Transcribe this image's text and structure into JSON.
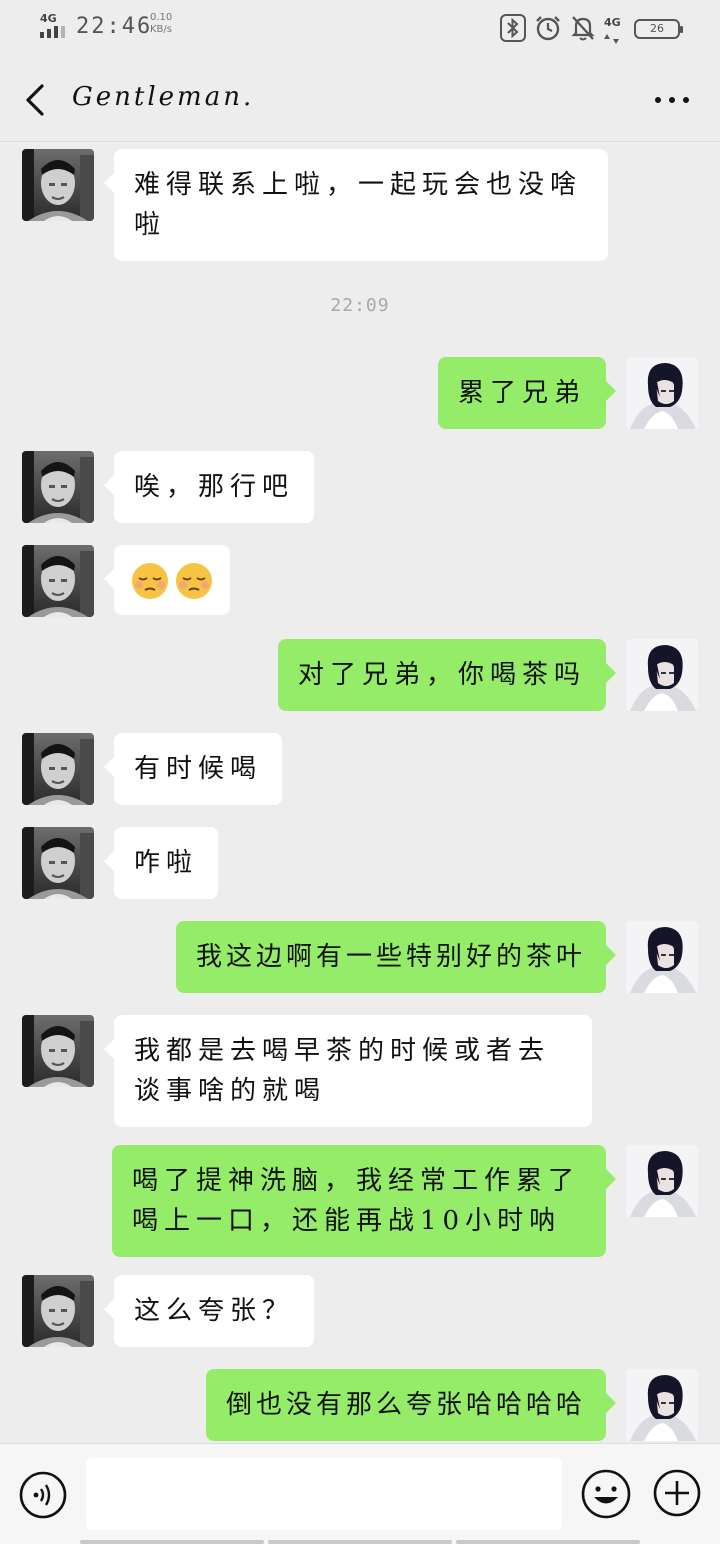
{
  "status_bar": {
    "network_type": "4G",
    "time": "22:46",
    "speed_value": "0.10",
    "speed_unit": "KB/s",
    "battery_level": "26",
    "right_network_type": "4G",
    "icons": [
      "signal-icon",
      "bluetooth-icon",
      "alarm-icon",
      "mute-icon",
      "mobile-data-icon",
      "battery-icon"
    ]
  },
  "header": {
    "title": "Gentleman.",
    "back_icon": "chevron-left-icon",
    "more_icon": "more-dots-icon"
  },
  "messages": [
    {
      "side": "left",
      "text": "难得联系上啦，一起玩会也没啥啦"
    },
    {
      "type": "time",
      "text": "22:09"
    },
    {
      "side": "right",
      "text": "累了兄弟"
    },
    {
      "side": "left",
      "text": "唉，那行吧"
    },
    {
      "side": "left",
      "emoji": [
        "🥲",
        "🥲"
      ],
      "emoji_name": "relieved-face-icon"
    },
    {
      "side": "right",
      "text": "对了兄弟，你喝茶吗"
    },
    {
      "side": "left",
      "text": "有时候喝"
    },
    {
      "side": "left",
      "text": "咋啦"
    },
    {
      "side": "right",
      "text": "我这边啊有一些特别好的茶叶"
    },
    {
      "side": "left",
      "text": "我都是去喝早茶的时候或者去谈事啥的就喝"
    },
    {
      "side": "right",
      "text": "喝了提神洗脑，我经常工作累了喝上一口，还能再战10小时呐"
    },
    {
      "side": "left",
      "text": "这么夸张？"
    },
    {
      "side": "right",
      "text": "倒也没有那么夸张哈哈哈哈"
    }
  ],
  "input_bar": {
    "placeholder": "",
    "value": "",
    "voice_icon": "voice-icon",
    "emoji_icon": "emoji-smile-icon",
    "plus_icon": "plus-circle-icon"
  },
  "colors": {
    "background": "#ededed",
    "sent_bubble": "#95ec69",
    "received_bubble": "#ffffff"
  }
}
